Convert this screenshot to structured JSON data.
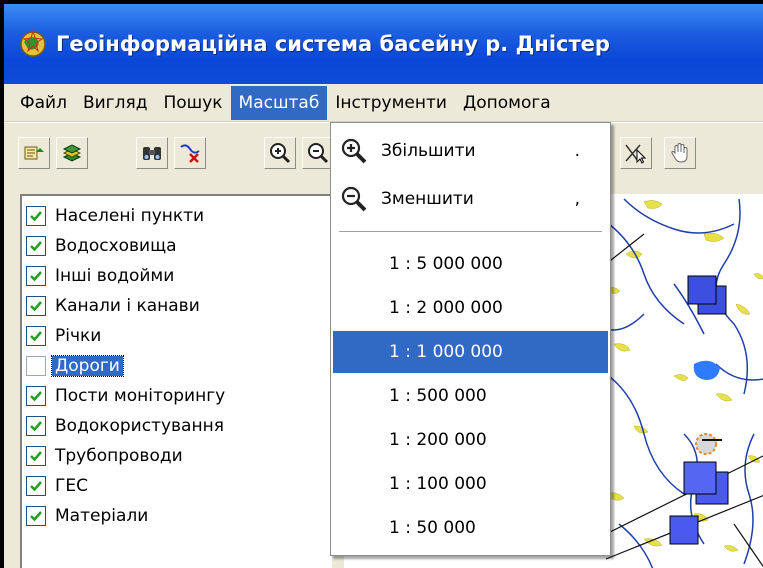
{
  "window": {
    "title": "Геоінформаційна система басейну р. Дністер"
  },
  "menu": {
    "items": [
      {
        "label": "Файл"
      },
      {
        "label": "Вигляд"
      },
      {
        "label": "Пошук"
      },
      {
        "label": "Масштаб"
      },
      {
        "label": "Інструменти"
      },
      {
        "label": "Допомога"
      }
    ],
    "active": "Масштаб"
  },
  "toolbar": {
    "icons": [
      "layer-add-icon",
      "layers-icon",
      "binoculars-icon",
      "clear-selection-icon",
      "zoom-in-icon",
      "zoom-out-icon",
      "select-arrow-icon",
      "pan-hand-icon"
    ]
  },
  "layers": {
    "items": [
      {
        "label": "Населені пункти",
        "checked": true
      },
      {
        "label": "Водосховища",
        "checked": true
      },
      {
        "label": "Інші водойми",
        "checked": true
      },
      {
        "label": "Канали і канави",
        "checked": true
      },
      {
        "label": "Річки",
        "checked": true
      },
      {
        "label": "Дороги",
        "checked": false,
        "selected": true
      },
      {
        "label": "Пости моніторингу",
        "checked": true
      },
      {
        "label": "Водокористування",
        "checked": true
      },
      {
        "label": "Трубопроводи",
        "checked": true
      },
      {
        "label": "ГЕС",
        "checked": true
      },
      {
        "label": "Матеріали",
        "checked": true
      }
    ]
  },
  "scale_menu": {
    "zoom_in": {
      "label": "Збільшити",
      "shortcut": ".",
      "icon": "zoom-in-icon"
    },
    "zoom_out": {
      "label": "Зменшити",
      "shortcut": ",",
      "icon": "zoom-out-icon"
    },
    "scales": [
      {
        "label": "1 : 5 000 000"
      },
      {
        "label": "1 : 2 000 000"
      },
      {
        "label": "1 : 1 000 000",
        "highlighted": true
      },
      {
        "label": "1 : 500 000"
      },
      {
        "label": "1 : 200 000"
      },
      {
        "label": "1 : 100 000"
      },
      {
        "label": "1 : 50 000"
      }
    ]
  },
  "colors": {
    "titlebar": "#0a47d6",
    "highlight": "#316ac5",
    "river": "#1f3fa8",
    "lake_fill": "#e6e04a",
    "monitoring_square": "#3c4fe0"
  }
}
